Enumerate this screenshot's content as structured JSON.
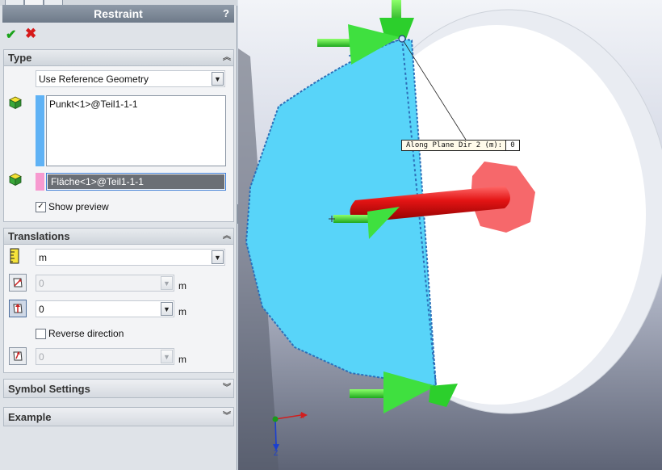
{
  "panel": {
    "title": "Restraint",
    "help_label": "?",
    "ok_icon": "checkmark-icon",
    "cancel_icon": "x-icon"
  },
  "type_group": {
    "header": "Type",
    "restraint_type": "Use Reference Geometry",
    "entities": [
      "Punkt<1>@Teil1-1-1"
    ],
    "reference": "Fläche<1>@Teil1-1-1",
    "show_preview_label": "Show preview",
    "show_preview_checked": true,
    "entity_color": "#5fb2f5",
    "reference_color": "#f79ad0"
  },
  "translations_group": {
    "header": "Translations",
    "unit_select": "m",
    "dir1_value": "0",
    "dir1_unit": "m",
    "dir2_value": "0",
    "dir2_unit": "m",
    "reverse_label": "Reverse direction",
    "reverse_checked": false,
    "normal_value": "0",
    "normal_unit": "m"
  },
  "symbol_settings": {
    "header": "Symbol Settings"
  },
  "example": {
    "header": "Example"
  },
  "viewport": {
    "callout_label": "Along Plane Dir 2 (m):",
    "callout_value": "0",
    "triad_icon": "coordinate-triad-icon"
  }
}
